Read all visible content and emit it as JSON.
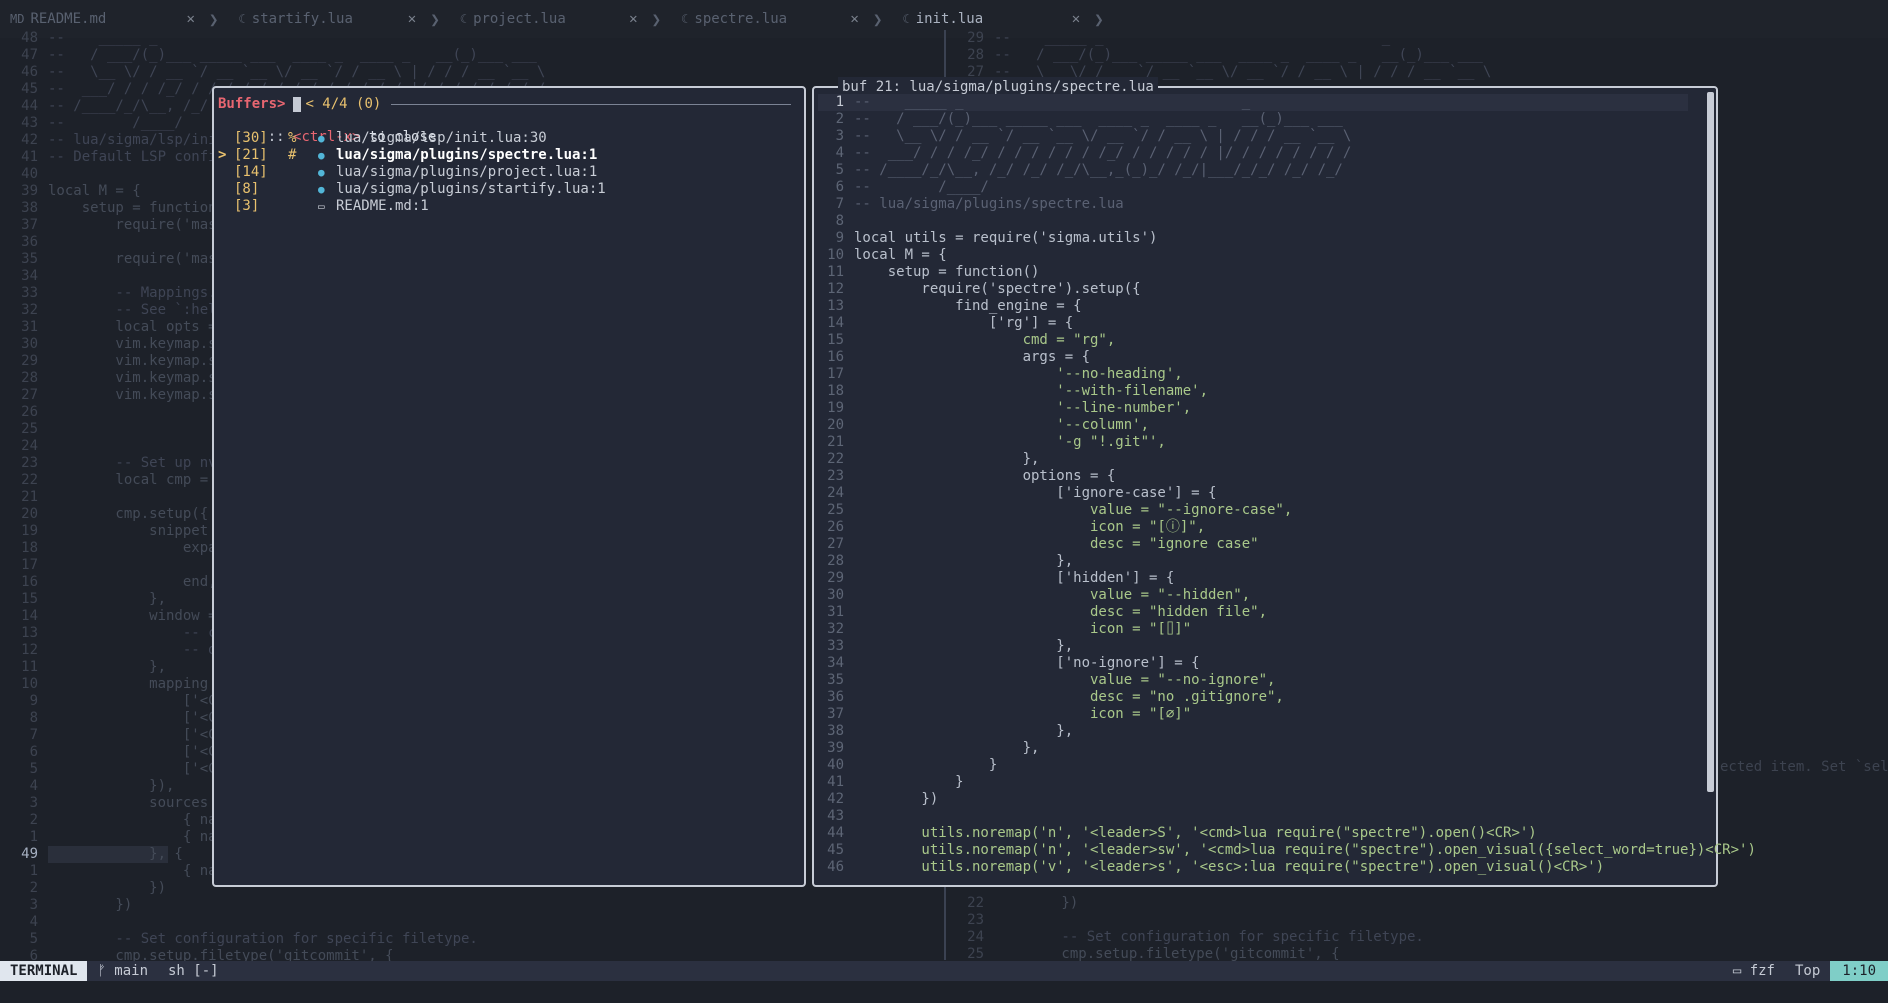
{
  "tabs": [
    {
      "icon": "markdown-icon",
      "label": "README.md",
      "close": "✕"
    },
    {
      "icon": "lua-icon",
      "label": "startify.lua",
      "close": "✕"
    },
    {
      "icon": "lua-icon",
      "label": "project.lua",
      "close": "✕"
    },
    {
      "icon": "lua-icon",
      "label": "spectre.lua",
      "close": "✕"
    },
    {
      "icon": "lua-icon",
      "label": "init.lua",
      "close": "✕"
    }
  ],
  "left_pane": {
    "lines": [
      {
        "ln": "48",
        "text": "--    _____ _"
      },
      {
        "ln": "47",
        "text": "--   / ___/(_)___ _____ ___  ____ _  ____ _   __(_)___ ___"
      },
      {
        "ln": "46",
        "text": "--   \\__ \\/ / __ `/ __ `__ \\/ __ `/ / __ \\ | / / / __ `__ \\"
      },
      {
        "ln": "45",
        "text": "--  ___/ / / /_/ / / / / / / /_/ / / / / / |/ / / / / / / /"
      },
      {
        "ln": "44",
        "text": "-- /____/_/\\__, /_/ /_/ /_/\\__,_(_)_/ /_/|___/_/_/ /_/ /_/"
      },
      {
        "ln": "43",
        "text": "--        /____/"
      },
      {
        "ln": "42",
        "text": "-- lua/sigma/lsp/init.lua"
      },
      {
        "ln": "41",
        "text": "-- Default LSP config"
      },
      {
        "ln": "40",
        "text": ""
      },
      {
        "ln": "39",
        "text": "local M = {"
      },
      {
        "ln": "38",
        "text": "    setup = function"
      },
      {
        "ln": "37",
        "text": "        require('mas"
      },
      {
        "ln": "36",
        "text": ""
      },
      {
        "ln": "35",
        "text": "        require('mas"
      },
      {
        "ln": "34",
        "text": ""
      },
      {
        "ln": "33",
        "text": "        -- Mappings."
      },
      {
        "ln": "32",
        "text": "        -- See `:hel"
      },
      {
        "ln": "31",
        "text": "        local opts ="
      },
      {
        "ln": "30",
        "text": "        vim.keymap.s"
      },
      {
        "ln": "29",
        "text": "        vim.keymap.s"
      },
      {
        "ln": "28",
        "text": "        vim.keymap.s"
      },
      {
        "ln": "27",
        "text": "        vim.keymap.s"
      },
      {
        "ln": "26",
        "text": ""
      },
      {
        "ln": "25",
        "text": ""
      },
      {
        "ln": "24",
        "text": ""
      },
      {
        "ln": "23",
        "text": "        -- Set up nv"
      },
      {
        "ln": "22",
        "text": "        local cmp ="
      },
      {
        "ln": "21",
        "text": ""
      },
      {
        "ln": "20",
        "text": "        cmp.setup({"
      },
      {
        "ln": "19",
        "text": "            snippet"
      },
      {
        "ln": "18",
        "text": "                expa"
      },
      {
        "ln": "17",
        "text": ""
      },
      {
        "ln": "16",
        "text": "                end,"
      },
      {
        "ln": "15",
        "text": "            },"
      },
      {
        "ln": "14",
        "text": "            window ="
      },
      {
        "ln": "13",
        "text": "                -- c"
      },
      {
        "ln": "12",
        "text": "                -- d"
      },
      {
        "ln": "11",
        "text": "            },"
      },
      {
        "ln": "10",
        "text": "            mapping"
      },
      {
        "ln": "9",
        "text": "                ['<C"
      },
      {
        "ln": "8",
        "text": "                ['<C"
      },
      {
        "ln": "7",
        "text": "                ['<C"
      },
      {
        "ln": "6",
        "text": "                ['<C"
      },
      {
        "ln": "5",
        "text": "                ['<C"
      },
      {
        "ln": "4",
        "text": "            }),"
      },
      {
        "ln": "3",
        "text": "            sources"
      },
      {
        "ln": "2",
        "text": "                { na"
      },
      {
        "ln": "1",
        "text": "                { na"
      },
      {
        "ln": "49",
        "text": "            }, {"
      },
      {
        "ln": "1",
        "text": "                { na"
      },
      {
        "ln": "2",
        "text": "            })"
      },
      {
        "ln": "3",
        "text": "        })"
      },
      {
        "ln": "4",
        "text": ""
      },
      {
        "ln": "5",
        "text": "        -- Set configuration for specific filetype."
      },
      {
        "ln": "6",
        "text": "        cmp.setup.filetype('gitcommit', {"
      }
    ]
  },
  "right_pane": {
    "top_lines": [
      {
        "ln": "29",
        "text": "--    _____ _                                 _"
      },
      {
        "ln": "28",
        "text": "--   / ___/(_)___ _____ ___  ____ _  ____ _   __(_)___ ___"
      },
      {
        "ln": "27",
        "text": "--   \\__ \\/ / __ `/ __ `__ \\/ __ `/ / __ \\ | / / / __ `__ \\"
      }
    ],
    "bottom_lines": [
      {
        "ln": "22",
        "text": "        })"
      },
      {
        "ln": "23",
        "text": ""
      },
      {
        "ln": "24",
        "text": "        -- Set configuration for specific filetype."
      },
      {
        "ln": "25",
        "text": "        cmp.setup.filetype('gitcommit', {"
      }
    ],
    "side_text": "ected item. Set `sele"
  },
  "buffers": {
    "prompt": "Buffers>",
    "count": "< 4/4 (0)",
    "hint_prefix": ":: ",
    "hint_key": "<ctrl-x>",
    "hint_suffix": " to close",
    "items": [
      {
        "arrow": "",
        "num": "[30]",
        "flag": "%",
        "name": "lua/sigma/lsp/init.lua:30",
        "selected": false
      },
      {
        "arrow": ">",
        "num": "[21]",
        "flag": "#",
        "name": "lua/sigma/plugins/spectre.lua:1",
        "selected": true
      },
      {
        "arrow": "",
        "num": "[14]",
        "flag": "",
        "name": "lua/sigma/plugins/project.lua:1",
        "selected": false
      },
      {
        "arrow": "",
        "num": "[8]",
        "flag": "",
        "name": "lua/sigma/plugins/startify.lua:1",
        "selected": false
      },
      {
        "arrow": "",
        "num": "[3]",
        "flag": "",
        "name": "README.md:1",
        "selected": false
      }
    ]
  },
  "preview": {
    "title": "buf 21: lua/sigma/plugins/spectre.lua",
    "lines": [
      "--    _____ _                                 _",
      "--   / ___/(_)___ _____ ___  ____ _  ____ _   __(_)___ ___",
      "--   \\__ \\/ / __ `/ __ `__ \\/ __ `/ / __ \\ | / / / __ `__ \\",
      "--  ___/ / / /_/ / / / / / / /_/ / / / / / |/ / / / / / / /",
      "-- /____/_/\\__, /_/ /_/ /_/\\__,_(_)_/ /_/|___/_/_/ /_/ /_/",
      "--        /____/",
      "-- lua/sigma/plugins/spectre.lua",
      "",
      "local utils = require('sigma.utils')",
      "local M = {",
      "    setup = function()",
      "        require('spectre').setup({",
      "            find_engine = {",
      "                ['rg'] = {",
      "                    cmd = \"rg\",",
      "                    args = {",
      "                        '--no-heading',",
      "                        '--with-filename',",
      "                        '--line-number',",
      "                        '--column',",
      "                        '-g \"!.git\"',",
      "                    },",
      "                    options = {",
      "                        ['ignore-case'] = {",
      "                            value = \"--ignore-case\",",
      "                            icon = \"[ⓘ]\",",
      "                            desc = \"ignore case\"",
      "                        },",
      "                        ['hidden'] = {",
      "                            value = \"--hidden\",",
      "                            desc = \"hidden file\",",
      "                            icon = \"[⌷]\"",
      "                        },",
      "                        ['no-ignore'] = {",
      "                            value = \"--no-ignore\",",
      "                            desc = \"no .gitignore\",",
      "                            icon = \"[⌀]\"",
      "                        },",
      "                    },",
      "                }",
      "            }",
      "        })",
      "",
      "        utils.noremap('n', '<leader>S', '<cmd>lua require(\"spectre\").open()<CR>')",
      "        utils.noremap('n', '<leader>sw', '<cmd>lua require(\"spectre\").open_visual({select_word=true})<CR>')",
      "        utils.noremap('v', '<leader>s', '<esc>:lua require(\"spectre\").open_visual()<CR>')"
    ]
  },
  "statusline": {
    "mode": "TERMINAL",
    "branch": "main",
    "shell": "sh [-]",
    "filetype": "fzf",
    "position": "Top",
    "linecol": "1:10"
  },
  "colors": {
    "background": "#1d2129",
    "float_bg": "#232836",
    "accent_yellow": "#e8c16e",
    "accent_red": "#e86671",
    "accent_cyan": "#7fcec7"
  }
}
